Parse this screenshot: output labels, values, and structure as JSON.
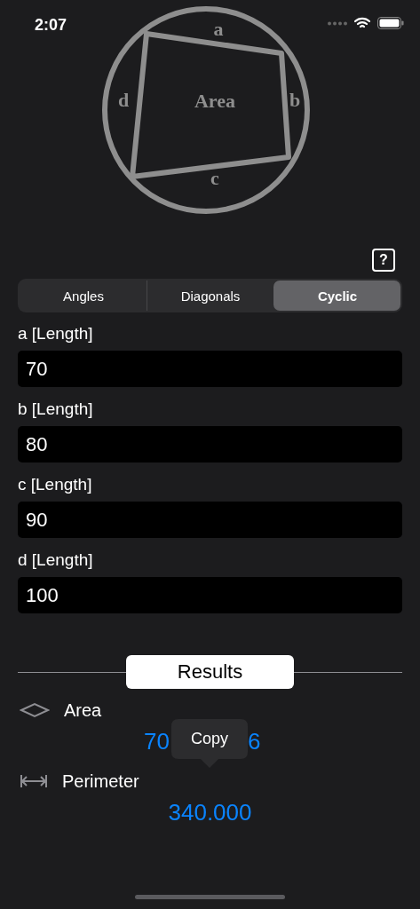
{
  "status_bar": {
    "time": "2:07"
  },
  "diagram": {
    "labels": {
      "a": "a",
      "b": "b",
      "c": "c",
      "d": "d",
      "center": "Area"
    }
  },
  "help_button": {
    "label": "?"
  },
  "tabs": [
    {
      "label": "Angles",
      "selected": false
    },
    {
      "label": "Diagonals",
      "selected": false
    },
    {
      "label": "Cyclic",
      "selected": true
    }
  ],
  "fields": [
    {
      "label": "a [Length]",
      "value": "70"
    },
    {
      "label": "b [Length]",
      "value": "80"
    },
    {
      "label": "c [Length]",
      "value": "90"
    },
    {
      "label": "d [Length]",
      "value": "100"
    }
  ],
  "results": {
    "title": "Results",
    "items": [
      {
        "kind": "area",
        "label": "Area",
        "value_parts": [
          "70",
          "6"
        ]
      },
      {
        "kind": "perimeter",
        "label": "Perimeter",
        "value": "340.000"
      }
    ]
  },
  "tooltip": {
    "text": "Copy"
  }
}
